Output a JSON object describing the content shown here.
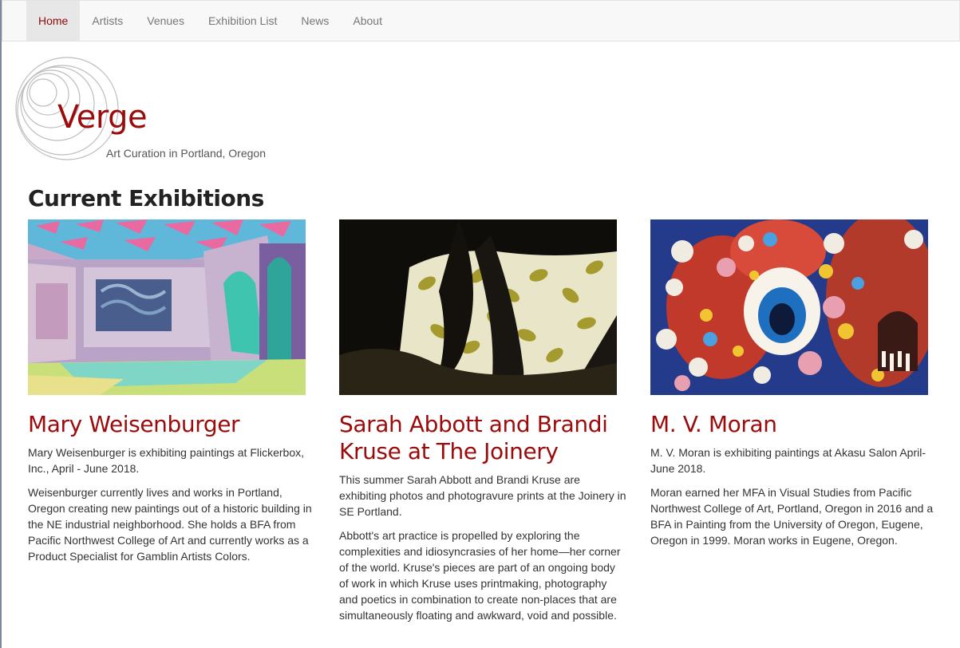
{
  "nav": {
    "items": [
      {
        "label": "Home",
        "active": true
      },
      {
        "label": "Artists",
        "active": false
      },
      {
        "label": "Venues",
        "active": false
      },
      {
        "label": "Exhibition List",
        "active": false
      },
      {
        "label": "News",
        "active": false
      },
      {
        "label": "About",
        "active": false
      }
    ]
  },
  "brand": {
    "name": "Verge",
    "tagline": "Art Curation in Portland, Oregon",
    "accent": "#9b0b0b"
  },
  "section_title": "Current Exhibitions",
  "exhibitions": [
    {
      "title": "Mary Weisenburger",
      "summary": "Mary Weisenburger is exhibiting paintings at Flickerbox, Inc., April - June 2018.",
      "body": "Weisenburger currently lives and works in Portland, Oregon creating new paintings out of a historic building in the NE industrial neighborhood. She holds a BFA from Pacific Northwest College of Art and currently works as a Product Specialist for Gamblin Artists Colors."
    },
    {
      "title": "Sarah Abbott and Brandi Kruse at The Joinery",
      "summary": "This summer Sarah Abbott and Brandi Kruse are exhibiting photos and photogravure prints at the Joinery in SE Portland.",
      "body": "Abbott's art practice is propelled by exploring the complexities and idiosyncrasies of her home—her corner of the world. Kruse's pieces are part of an ongoing body of work in which Kruse uses printmaking, photography and poetics in combination to create non-places that are simultaneously floating and awkward, void and possible."
    },
    {
      "title": "M. V. Moran",
      "summary": "M. V. Moran is exhibiting paintings at Akasu Salon April-June 2018.",
      "body": "Moran earned her MFA in Visual Studies from Pacific Northwest College of Art, Portland, Oregon in 2016 and a BFA in Painting from the University of Oregon, Eugene, Oregon in 1999. Moran works in Eugene, Oregon."
    }
  ]
}
